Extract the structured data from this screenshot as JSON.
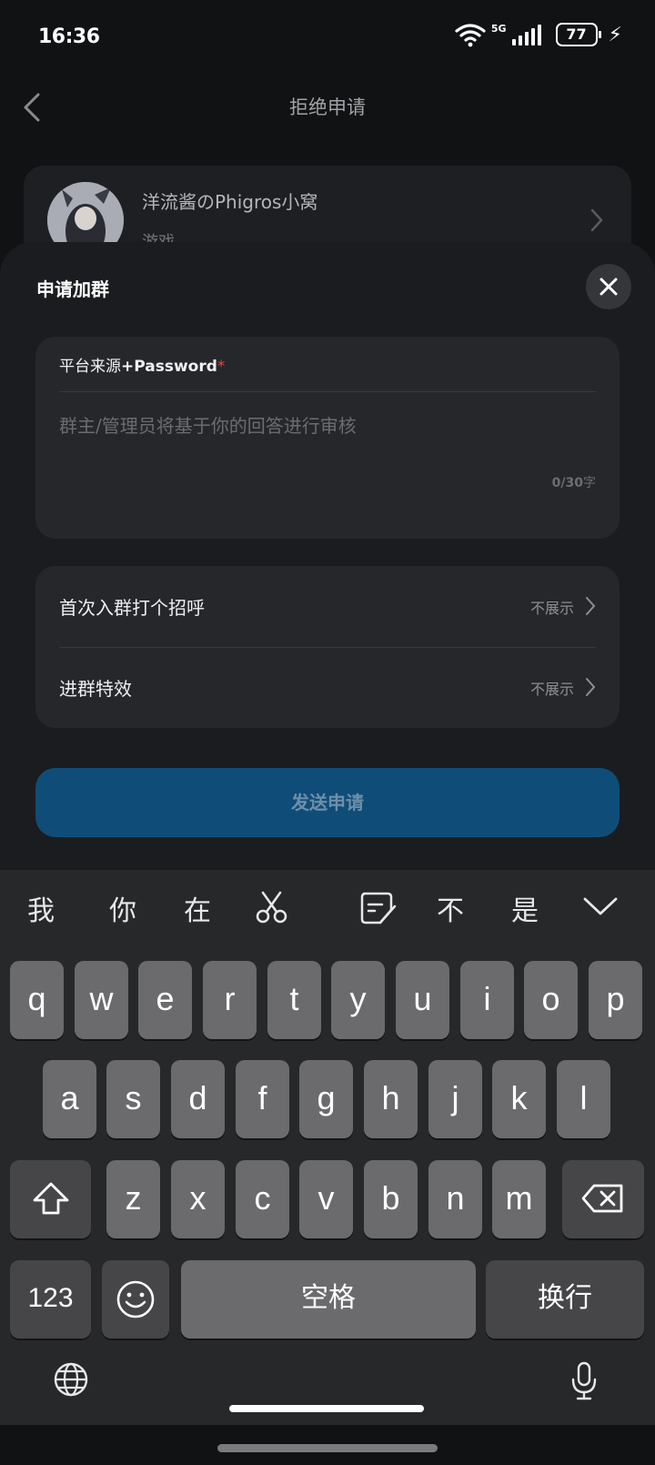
{
  "status_bar": {
    "time": "16:36",
    "network": "5G",
    "battery": "77"
  },
  "header": {
    "title": "拒绝申请"
  },
  "group_card": {
    "name": "洋流酱のPhigros小窝",
    "subtitle": "游戏"
  },
  "sheet": {
    "title": "申请加群",
    "question": {
      "prefix": "平台来源",
      "bold": "+Password",
      "required_mark": "*"
    },
    "answer_placeholder": "群主/管理员将基于你的回答进行审核",
    "counter": {
      "value": "0/30",
      "unit": "字"
    },
    "settings": [
      {
        "label": "首次入群打个招呼",
        "value": "不展示"
      },
      {
        "label": "进群特效",
        "value": "不展示"
      }
    ],
    "send_button": "发送申请"
  },
  "keyboard": {
    "candidates": [
      "我",
      "你",
      "在",
      "不",
      "是"
    ],
    "row1": [
      "q",
      "w",
      "e",
      "r",
      "t",
      "y",
      "u",
      "i",
      "o",
      "p"
    ],
    "row2": [
      "a",
      "s",
      "d",
      "f",
      "g",
      "h",
      "j",
      "k",
      "l"
    ],
    "row3": [
      "z",
      "x",
      "c",
      "v",
      "b",
      "n",
      "m"
    ],
    "numbers_key": "123",
    "space_key": "空格",
    "enter_key": "换行"
  },
  "colors": {
    "background": "#111214",
    "sheet": "#1b1c1f",
    "card": "#26272b",
    "primary_button": "#0f4d78",
    "required": "#e0473f",
    "key": "#6b6b6d",
    "key_dark": "#464648"
  },
  "icons": [
    "wifi-icon",
    "signal-icon",
    "battery-icon",
    "charging-icon",
    "back-arrow-icon",
    "chevron-right-icon",
    "close-icon",
    "scissors-icon",
    "sticker-icon",
    "collapse-keyboard-icon",
    "shift-icon",
    "backspace-icon",
    "emoji-icon",
    "globe-icon",
    "microphone-icon"
  ]
}
